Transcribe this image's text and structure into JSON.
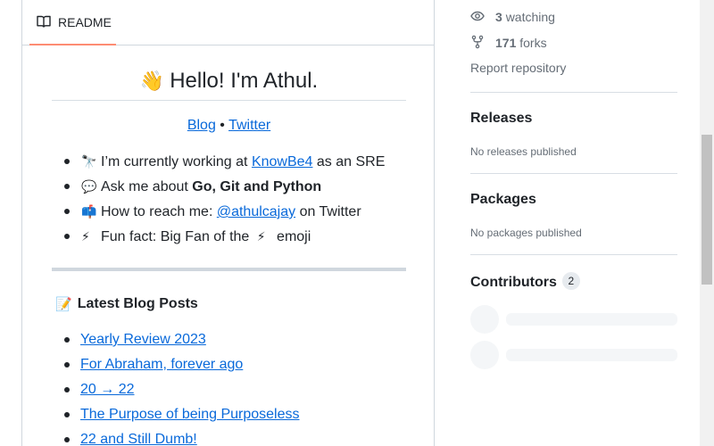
{
  "readme": {
    "tab_label": "README",
    "tab_icon": "book-icon",
    "title_emoji": "👋",
    "title": "Hello! I'm Athul.",
    "links": {
      "blog": "Blog",
      "separator": "•",
      "twitter": "Twitter"
    },
    "facts": [
      {
        "emoji": "🔭",
        "prefix": "I’m currently working at ",
        "link": "KnowBe4",
        "suffix": " as an SRE"
      },
      {
        "emoji": "💬",
        "prefix": "Ask me about ",
        "bold": "Go, Git and Python"
      },
      {
        "emoji": "📫",
        "prefix": "How to reach me: ",
        "link": "@athulcajay",
        "suffix": " on Twitter"
      },
      {
        "emoji": "⚡",
        "prefix": "Fun fact: Big Fan of the ",
        "emoji2": "⚡",
        "suffix": " emoji"
      }
    ],
    "posts_emoji": "📝",
    "posts_heading": "Latest Blog Posts",
    "posts": [
      "Yearly Review 2023",
      "For Abraham, forever ago",
      "20 → 22",
      "The Purpose of being Purposeless",
      "22 and Still Dumb!"
    ]
  },
  "sidebar": {
    "watching_count": "3",
    "watching_label": "watching",
    "forks_count": "171",
    "forks_label": "forks",
    "report_label": "Report repository",
    "releases_heading": "Releases",
    "releases_empty": "No releases published",
    "packages_heading": "Packages",
    "packages_empty": "No packages published",
    "contributors_heading": "Contributors",
    "contributors_count": "2"
  },
  "colors": {
    "link": "#0969da",
    "tab_underline": "#fd8c73",
    "muted": "#656d76"
  }
}
